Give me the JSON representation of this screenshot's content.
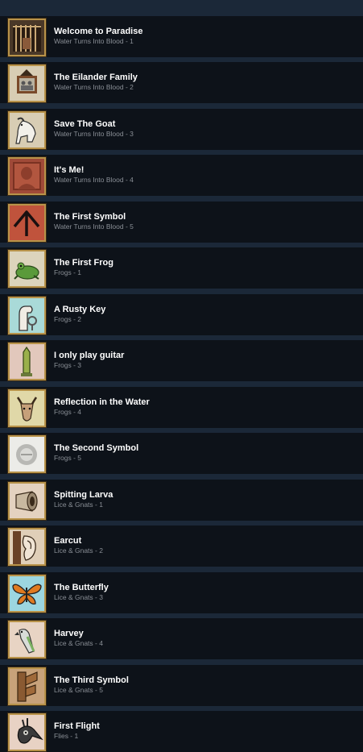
{
  "achievements": [
    {
      "title": "Welcome to Paradise",
      "subtitle": "Water Turns Into Blood - 1",
      "icon": "cage-icon"
    },
    {
      "title": "The Eilander Family",
      "subtitle": "Water Turns Into Blood - 2",
      "icon": "family-portrait-icon"
    },
    {
      "title": "Save The Goat",
      "subtitle": "Water Turns Into Blood - 3",
      "icon": "goat-icon"
    },
    {
      "title": "It's Me!",
      "subtitle": "Water Turns Into Blood - 4",
      "icon": "portrait-icon"
    },
    {
      "title": "The First Symbol",
      "subtitle": "Water Turns Into Blood - 5",
      "icon": "symbol-icon"
    },
    {
      "title": "The First Frog",
      "subtitle": "Frogs - 1",
      "icon": "frog-icon"
    },
    {
      "title": "A Rusty Key",
      "subtitle": "Frogs - 2",
      "icon": "hand-key-icon"
    },
    {
      "title": "I only play guitar",
      "subtitle": "Frogs - 3",
      "icon": "obelisk-icon"
    },
    {
      "title": "Reflection in the Water",
      "subtitle": "Frogs - 4",
      "icon": "goat-head-icon"
    },
    {
      "title": "The Second Symbol",
      "subtitle": "Frogs - 5",
      "icon": "eye-symbol-icon"
    },
    {
      "title": "Spitting Larva",
      "subtitle": "Lice & Gnats - 1",
      "icon": "larva-icon"
    },
    {
      "title": "Earcut",
      "subtitle": "Lice & Gnats - 2",
      "icon": "ear-icon"
    },
    {
      "title": "The Butterfly",
      "subtitle": "Lice & Gnats - 3",
      "icon": "butterfly-icon"
    },
    {
      "title": "Harvey",
      "subtitle": "Lice & Gnats - 4",
      "icon": "parrot-icon"
    },
    {
      "title": "The Third Symbol",
      "subtitle": "Lice & Gnats - 5",
      "icon": "wood-symbol-icon"
    },
    {
      "title": "First Flight",
      "subtitle": "Flies - 1",
      "icon": "bird-mask-icon"
    }
  ]
}
